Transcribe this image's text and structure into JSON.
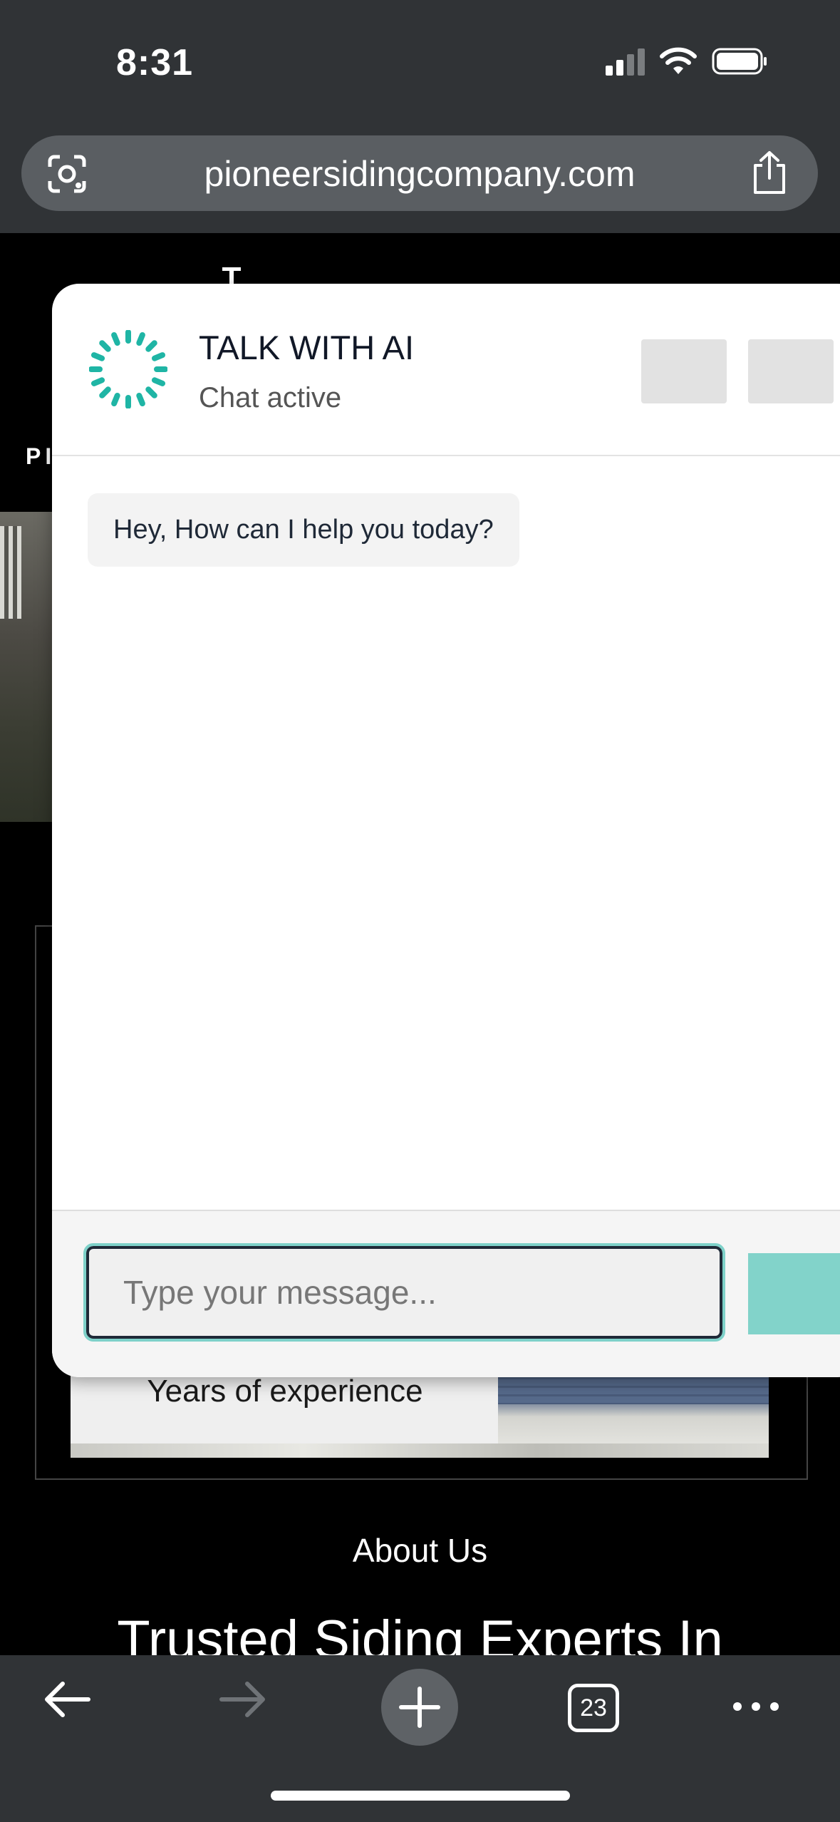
{
  "status_bar": {
    "time": "8:31"
  },
  "browser": {
    "url": "pioneersidingcompany.com",
    "tab_count": "23"
  },
  "site": {
    "nav_fragment": "PI",
    "stat_label": "Years of experience",
    "about_label": "About Us",
    "headline": "Trusted Siding Experts In"
  },
  "chat": {
    "title": "TALK WITH AI",
    "status": "Chat active",
    "messages": [
      {
        "from": "bot",
        "text": "Hey, How can I help you today?"
      }
    ],
    "input_placeholder": "Type your message...",
    "accent_color": "#1FB5A5"
  },
  "icons": {
    "lens": "google-lens-icon",
    "share": "share-icon",
    "back": "back-arrow-icon",
    "forward": "forward-arrow-icon",
    "new_tab": "plus-icon",
    "tabs": "tab-switcher-icon",
    "more": "more-dots-icon",
    "spinner": "loading-spinner-icon"
  }
}
